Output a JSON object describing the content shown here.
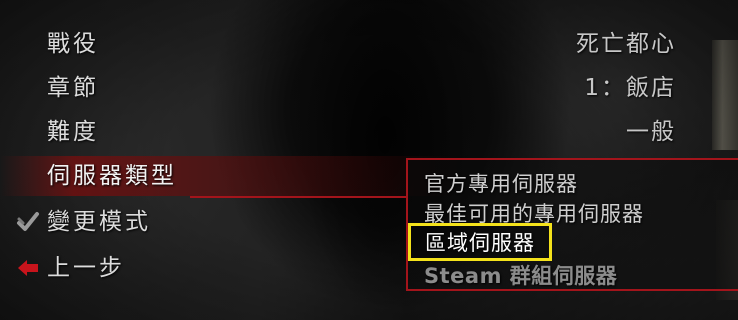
{
  "menu": {
    "campaign": {
      "label": "戰役",
      "value": "死亡都心"
    },
    "chapter": {
      "label": "章節",
      "value": "1：飯店"
    },
    "difficulty": {
      "label": "難度",
      "value": "一般"
    },
    "server_type": {
      "label": "伺服器類型"
    }
  },
  "dropdown": {
    "options": [
      {
        "label": "官方專用伺服器"
      },
      {
        "label": "最佳可用的專用伺服器"
      },
      {
        "label": "區域伺服器",
        "highlighted": true
      },
      {
        "label": "Steam 群組伺服器"
      }
    ]
  },
  "actions": {
    "change_mode": {
      "label": "變更模式",
      "icon": "checkmark-icon"
    },
    "back": {
      "label": "上一步",
      "icon": "back-arrow-icon"
    }
  },
  "colors": {
    "selection_red": "#a3141b",
    "highlight_yellow": "#f4e21b"
  }
}
